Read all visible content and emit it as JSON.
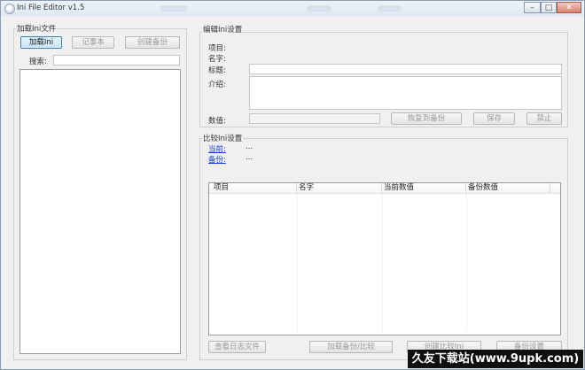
{
  "window": {
    "title": "Ini File Editor v1.5",
    "minimize": "–",
    "maximize": "□",
    "close": "✕"
  },
  "load_group": {
    "title": "加载Ini文件",
    "load_button": "加载Ini",
    "notepad_button": "记事本",
    "backup_button": "创建备份",
    "search_label": "搜索:",
    "search_value": ""
  },
  "edit_group": {
    "title": "编辑Ini设置",
    "item_label": "项目:",
    "name_label": "名字:",
    "title_label": "标题:",
    "title_value": "",
    "desc_label": "介绍:",
    "desc_value": "",
    "value_label": "数值:",
    "value_value": "",
    "restore_button": "恢复到备份",
    "save_button": "保存",
    "disable_button": "禁止"
  },
  "compare_group": {
    "title": "比较Ini设置",
    "current_link": "当前:",
    "current_value": "...",
    "backup_link": "备份:",
    "backup_value": "...",
    "columns": [
      "项目",
      "名字",
      "当前数值",
      "备份数值"
    ],
    "view_log_button": "查看日志文件",
    "load_backup_button": "加载备份/比较",
    "create_compare_button": "创建比较Ini",
    "backup_settings_button": "备份设置"
  },
  "watermark": "久友下载站(www.9upk.com)"
}
